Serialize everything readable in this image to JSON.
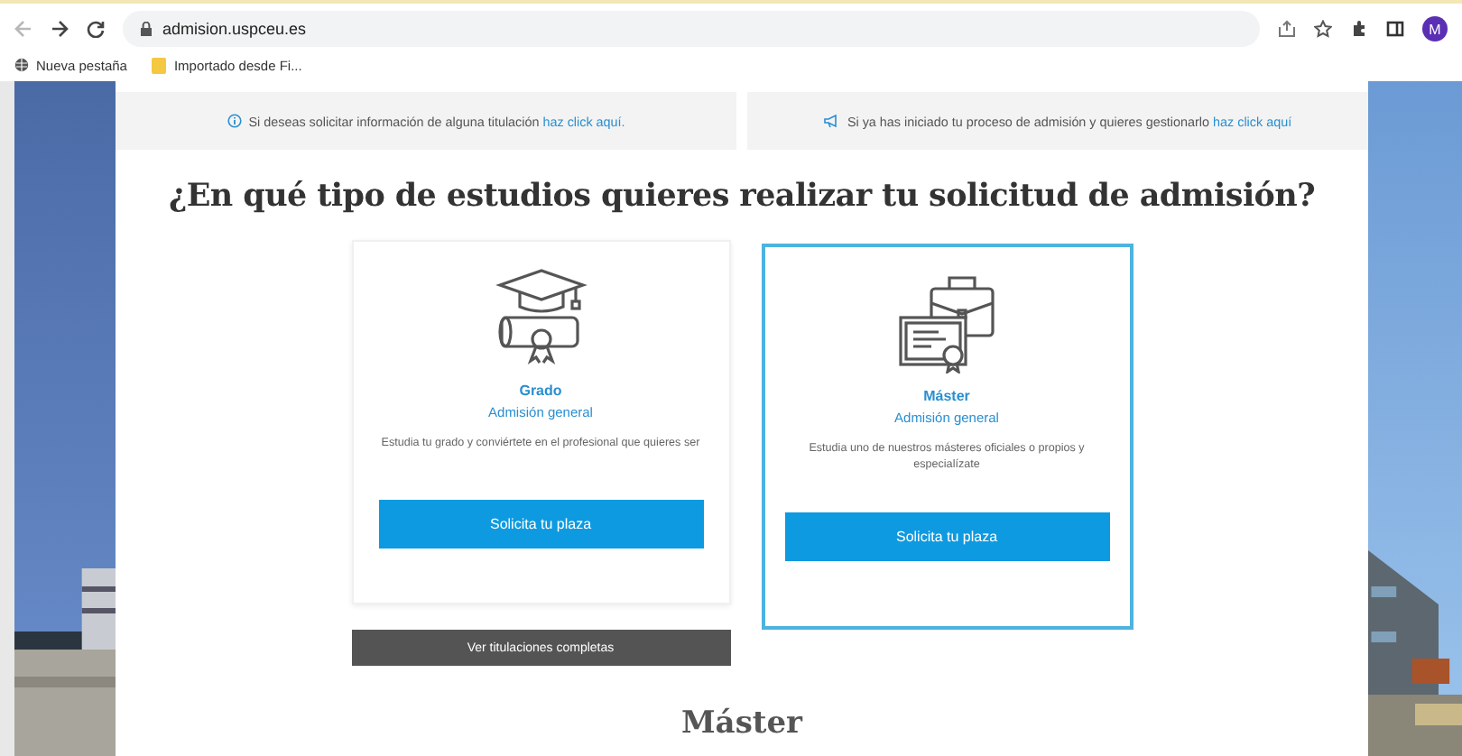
{
  "browser": {
    "back_disabled": true,
    "forward_disabled": false,
    "url": "admision.uspceu.es",
    "avatar": "M",
    "bookmarks": [
      {
        "kind": "globe",
        "label": "Nueva pestaña"
      },
      {
        "kind": "folder",
        "label": "Importado desde Fi..."
      }
    ]
  },
  "notices": [
    {
      "kind": "info",
      "text": "Si deseas solicitar información de alguna titulación ",
      "link": "haz click aquí."
    },
    {
      "kind": "megaphone",
      "text": "Si ya has iniciado tu proceso de admisión y quieres gestionarlo ",
      "link": "haz click aquí"
    }
  ],
  "heading": "¿En qué tipo de estudios quieres realizar tu solicitud de admisión?",
  "cards": [
    {
      "kind": "graduation",
      "selected": false,
      "title": "Grado",
      "subtitle": "Admisión general",
      "description": "Estudia tu grado y conviértete en el profesional que quieres ser",
      "button": "Solicita tu plaza",
      "extra_button": "Ver titulaciones completas"
    },
    {
      "kind": "briefcase",
      "selected": true,
      "title": "Máster",
      "subtitle": "Admisión general",
      "description": "Estudia uno de nuestros másteres oficiales o propios y especialízate",
      "button": "Solicita tu plaza"
    }
  ],
  "section_title": "Máster"
}
